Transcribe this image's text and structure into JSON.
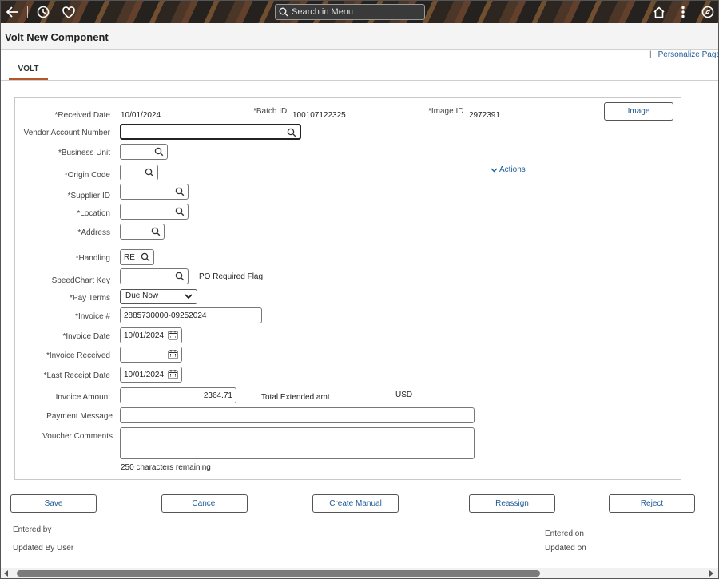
{
  "header": {
    "search_placeholder": "Search in Menu"
  },
  "page": {
    "title": "Volt New Component",
    "personalize_link": "Personalize Page"
  },
  "tabs": [
    {
      "label": "VOLT"
    }
  ],
  "form": {
    "received_date": {
      "label": "*Received Date",
      "value": "10/01/2024"
    },
    "batch_id": {
      "label": "*Batch ID",
      "value": "100107122325"
    },
    "image_id": {
      "label": "*Image ID",
      "value": "2972391"
    },
    "image_button": "Image",
    "vendor_account_number": {
      "label": "Vendor Account Number",
      "value": ""
    },
    "business_unit": {
      "label": "*Business Unit",
      "value": ""
    },
    "origin_code": {
      "label": "*Origin Code",
      "value": ""
    },
    "actions_link": "Actions",
    "supplier_id": {
      "label": "*Supplier ID",
      "value": ""
    },
    "location": {
      "label": "*Location",
      "value": ""
    },
    "address": {
      "label": "*Address",
      "value": ""
    },
    "handling": {
      "label": "*Handling",
      "value": "RE"
    },
    "speedchart_key": {
      "label": "SpeedChart Key",
      "value": ""
    },
    "po_required_flag": "PO Required Flag",
    "pay_terms": {
      "label": "*Pay Terms",
      "value": "Due Now"
    },
    "invoice_number": {
      "label": "*Invoice #",
      "value": "2885730000-09252024"
    },
    "invoice_date": {
      "label": "*Invoice Date",
      "value": "10/01/2024"
    },
    "invoice_received": {
      "label": "*Invoice Received",
      "value": ""
    },
    "last_receipt_date": {
      "label": "*Last Receipt Date",
      "value": "10/01/2024"
    },
    "invoice_amount": {
      "label": "Invoice Amount",
      "value": "2364.71"
    },
    "total_extended_amt": "Total Extended amt",
    "currency": "USD",
    "payment_message": {
      "label": "Payment Message",
      "value": ""
    },
    "voucher_comments": {
      "label": "Voucher Comments",
      "value": ""
    },
    "chars_remaining": "250 characters remaining"
  },
  "buttons": {
    "save": "Save",
    "cancel": "Cancel",
    "create_manual": "Create Manual",
    "reassign": "Reassign",
    "reject": "Reject"
  },
  "footer": {
    "entered_by": "Entered by",
    "updated_by_user": "Updated By User",
    "entered_on": "Entered on",
    "updated_on": "Updated on"
  },
  "colors": {
    "link": "#1f5a96",
    "tab_accent": "#b5562b"
  }
}
